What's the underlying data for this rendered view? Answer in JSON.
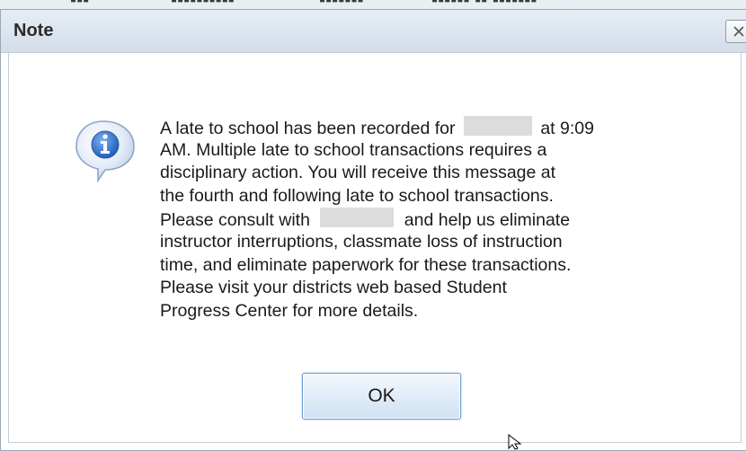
{
  "dialog": {
    "title": "Note",
    "close_label": "×",
    "message_lines": [
      {
        "before": "A late to school has been recorded for",
        "after": "at 9:09"
      },
      {
        "text": "AM. Multiple late to school transactions requires a"
      },
      {
        "text": "disciplinary action. You will receive this message at"
      },
      {
        "text": "the fourth and following late to school transactions."
      },
      {
        "before": "Please consult with",
        "after": "and help us eliminate"
      },
      {
        "text": "instructor interruptions, classmate loss of instruction"
      },
      {
        "text": "time, and eliminate paperwork for these transactions."
      },
      {
        "text": "Please visit your districts web based Student"
      },
      {
        "text": "Progress Center for more details."
      }
    ],
    "ok_label": "OK",
    "icon": "info-icon"
  },
  "colors": {
    "titlebar": "#d8e1ea",
    "accent": "#6d9ad1",
    "redaction": "#dcdcdc"
  }
}
